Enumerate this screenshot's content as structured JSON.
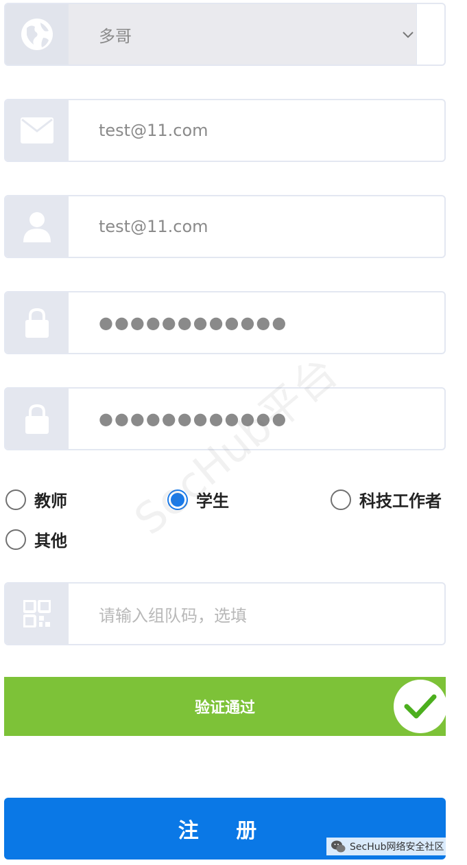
{
  "form": {
    "region": {
      "value": "多哥",
      "icon": "globe-icon"
    },
    "email": {
      "value": "test@11.com",
      "icon": "mail-icon"
    },
    "username": {
      "value": "test@11.com",
      "icon": "user-icon"
    },
    "password": {
      "value": "●●●●●●●●●●●●",
      "icon": "lock-icon"
    },
    "password_confirm": {
      "value": "●●●●●●●●●●●●",
      "icon": "lock-icon"
    },
    "roles": [
      {
        "label": "教师",
        "selected": false
      },
      {
        "label": "学生",
        "selected": true
      },
      {
        "label": "科技工作者",
        "selected": false
      },
      {
        "label": "其他",
        "selected": false
      }
    ],
    "team_code": {
      "placeholder": "请输入组队码，选填",
      "icon": "qrcode-icon"
    },
    "verify": {
      "label": "验证通过",
      "icon": "check-icon"
    },
    "register_label": "注 册"
  },
  "watermark": "SecHub平台",
  "credit": "SecHub网络安全社区",
  "colors": {
    "icon_bg": "#e4e7ef",
    "verify_green": "#7dc238",
    "register_blue": "#0a78e6",
    "radio_blue": "#1a7ae8"
  }
}
